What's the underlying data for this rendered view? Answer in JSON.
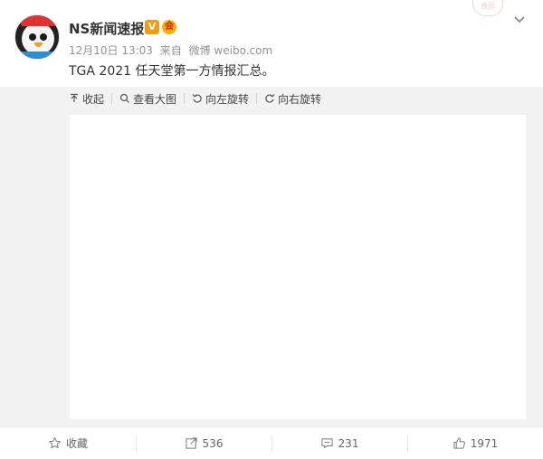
{
  "post": {
    "username": "NS新闻速报",
    "v_badge": "V",
    "member_badge": "会",
    "time": "12月10日 13:03",
    "source_prefix": "来自",
    "source": "微博 weibo.com",
    "text": "TGA 2021 任天堂第一方情报汇总。",
    "stamp": "会员"
  },
  "image_toolbar": {
    "collapse": "收起",
    "view_large": "查看大图",
    "rotate_left": "向左旋转",
    "rotate_right": "向右旋转"
  },
  "actions": {
    "favorite": "收藏",
    "repost": "536",
    "comment": "231",
    "like": "1971"
  },
  "colors": {
    "accent_v": "#f39c12",
    "background_media": "#f2f2f2"
  }
}
